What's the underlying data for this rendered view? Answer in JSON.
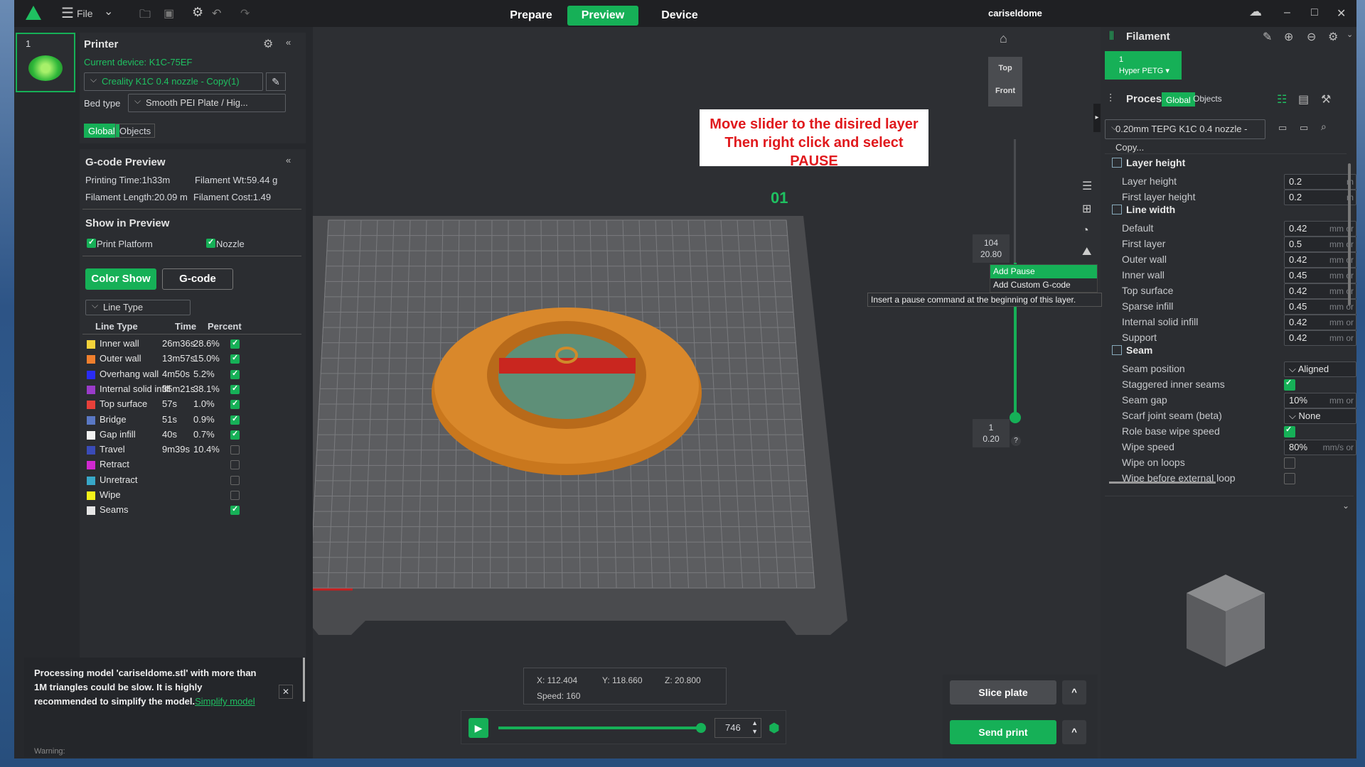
{
  "app": {
    "title": "cariseldome",
    "file_menu": "File",
    "tabs": [
      "Prepare",
      "Preview",
      "Device"
    ],
    "active_tab": "Preview",
    "accent": "#16b057"
  },
  "plate": {
    "number": "1"
  },
  "printer": {
    "title": "Printer",
    "current_device": "Current device: K1C-75EF",
    "profile": "Creality K1C 0.4 nozzle - Copy(1)",
    "bed_type_label": "Bed type",
    "bed_type": "Smooth PEI Plate / Hig...",
    "global": "Global",
    "objects": "Objects"
  },
  "gcode": {
    "title": "G-code Preview",
    "printing_time": "Printing Time:1h33m",
    "filament_wt": "Filament Wt:59.44 g",
    "filament_length": "Filament Length:20.09 m",
    "filament_cost": "Filament Cost:1.49",
    "show_title": "Show in Preview",
    "print_platform": "Print Platform",
    "nozzle": "Nozzle",
    "color_show": "Color Show",
    "gcode_btn": "G-code",
    "line_type_select": "Line Type",
    "headers": [
      "Line Type",
      "Time",
      "Percent"
    ],
    "rows": [
      {
        "name": "Inner wall",
        "time": "26m36s",
        "pct": "28.6%",
        "color": "#f3d23a",
        "on": true
      },
      {
        "name": "Outer wall",
        "time": "13m57s",
        "pct": "15.0%",
        "color": "#f07f2d",
        "on": true
      },
      {
        "name": "Overhang wall",
        "time": "4m50s",
        "pct": "5.2%",
        "color": "#2a2cf5",
        "on": true
      },
      {
        "name": "Internal solid infill",
        "time": "35m21s",
        "pct": "38.1%",
        "color": "#9a3bc9",
        "on": true
      },
      {
        "name": "Top surface",
        "time": "57s",
        "pct": "1.0%",
        "color": "#e8403a",
        "on": true
      },
      {
        "name": "Bridge",
        "time": "51s",
        "pct": "0.9%",
        "color": "#5a78c4",
        "on": true
      },
      {
        "name": "Gap infill",
        "time": "40s",
        "pct": "0.7%",
        "color": "#f2f2f2",
        "on": true
      },
      {
        "name": "Travel",
        "time": "9m39s",
        "pct": "10.4%",
        "color": "#3a4bb8",
        "on": false
      },
      {
        "name": "Retract",
        "time": "",
        "pct": "",
        "color": "#d028d0",
        "on": false
      },
      {
        "name": "Unretract",
        "time": "",
        "pct": "",
        "color": "#38a8c8",
        "on": false
      },
      {
        "name": "Wipe",
        "time": "",
        "pct": "",
        "color": "#f2f21a",
        "on": false
      },
      {
        "name": "Seams",
        "time": "",
        "pct": "",
        "color": "#e6e6e6",
        "on": true
      }
    ]
  },
  "notice": {
    "text": "Processing model 'cariseldome.stl' with more than 1M triangles could be slow. It is highly recommended to simplify the model.",
    "link": "Simplify model",
    "warning": "Warning:"
  },
  "viewport": {
    "callout_line1": "Move slider to the disired layer",
    "callout_line2": "Then right click and select PAUSE",
    "plate_label": "01",
    "view_top": "Top",
    "view_front": "Front",
    "slider_top_layer": "104",
    "slider_top_z": "20.80",
    "slider_bottom_layer": "1",
    "slider_bottom_z": "0.20",
    "help": "?",
    "menu_add_pause": "Add Pause",
    "menu_add_custom": "Add Custom G-code",
    "tooltip": "Insert a pause command at the beginning of this layer.",
    "coord_x": "X: 112.404",
    "coord_y": "Y: 118.660",
    "coord_z": "Z: 20.800",
    "speed": "Speed: 160",
    "move_value": "746",
    "slice_btn": "Slice plate",
    "send_btn": "Send print",
    "chev": "^"
  },
  "filament": {
    "title": "Filament",
    "slot": "1",
    "type": "Hyper PETG ▾"
  },
  "process": {
    "title": "Process",
    "global": "Global",
    "objects": "Objects",
    "preset": "0.20mm TEPG K1C 0.4 nozzle - Copy...",
    "sections": [
      {
        "name": "Layer height",
        "rows": [
          {
            "label": "Layer height",
            "value": "0.2",
            "unit": "m"
          },
          {
            "label": "First layer height",
            "value": "0.2",
            "unit": "m"
          }
        ]
      },
      {
        "name": "Line width",
        "rows": [
          {
            "label": "Default",
            "value": "0.42",
            "unit": "mm or"
          },
          {
            "label": "First layer",
            "value": "0.5",
            "unit": "mm or"
          },
          {
            "label": "Outer wall",
            "value": "0.42",
            "unit": "mm or"
          },
          {
            "label": "Inner wall",
            "value": "0.45",
            "unit": "mm or"
          },
          {
            "label": "Top surface",
            "value": "0.42",
            "unit": "mm or"
          },
          {
            "label": "Sparse infill",
            "value": "0.45",
            "unit": "mm or"
          },
          {
            "label": "Internal solid infill",
            "value": "0.42",
            "unit": "mm or"
          },
          {
            "label": "Support",
            "value": "0.42",
            "unit": "mm or"
          }
        ]
      },
      {
        "name": "Seam",
        "rows": [
          {
            "label": "Seam position",
            "value": "Aligned",
            "type": "select"
          },
          {
            "label": "Staggered inner seams",
            "type": "check",
            "on": true
          },
          {
            "label": "Seam gap",
            "value": "10%",
            "unit": "mm or"
          },
          {
            "label": "Scarf joint seam (beta)",
            "value": "None",
            "type": "select"
          },
          {
            "label": "Role base wipe speed",
            "type": "check",
            "on": true
          },
          {
            "label": "Wipe speed",
            "value": "80%",
            "unit": "mm/s or"
          },
          {
            "label": "Wipe on loops",
            "type": "check",
            "on": false
          },
          {
            "label": "Wipe before external loop",
            "type": "check",
            "on": false
          }
        ]
      }
    ]
  }
}
